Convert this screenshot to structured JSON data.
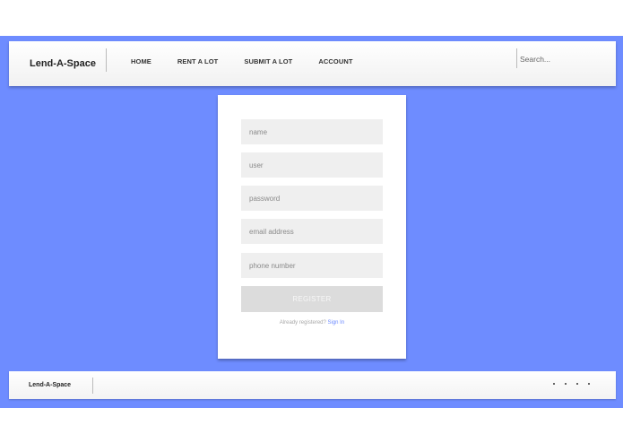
{
  "header": {
    "brand": "Lend-A-Space",
    "nav": [
      "HOME",
      "RENT A LOT",
      "SUBMIT A LOT",
      "ACCOUNT"
    ],
    "search_placeholder": "Search..."
  },
  "form": {
    "fields": {
      "name_placeholder": "name",
      "user_placeholder": "user",
      "password_placeholder": "password",
      "email_placeholder": "email address",
      "phone_placeholder": "phone number"
    },
    "register_label": "REGISTER",
    "signin_prompt": "Already registered?",
    "signin_link": "Sign In"
  },
  "footer": {
    "brand": "Lend-A-Space",
    "dots_count": 4
  },
  "colors": {
    "background": "#6e8cff",
    "link": "#6e8cff"
  }
}
